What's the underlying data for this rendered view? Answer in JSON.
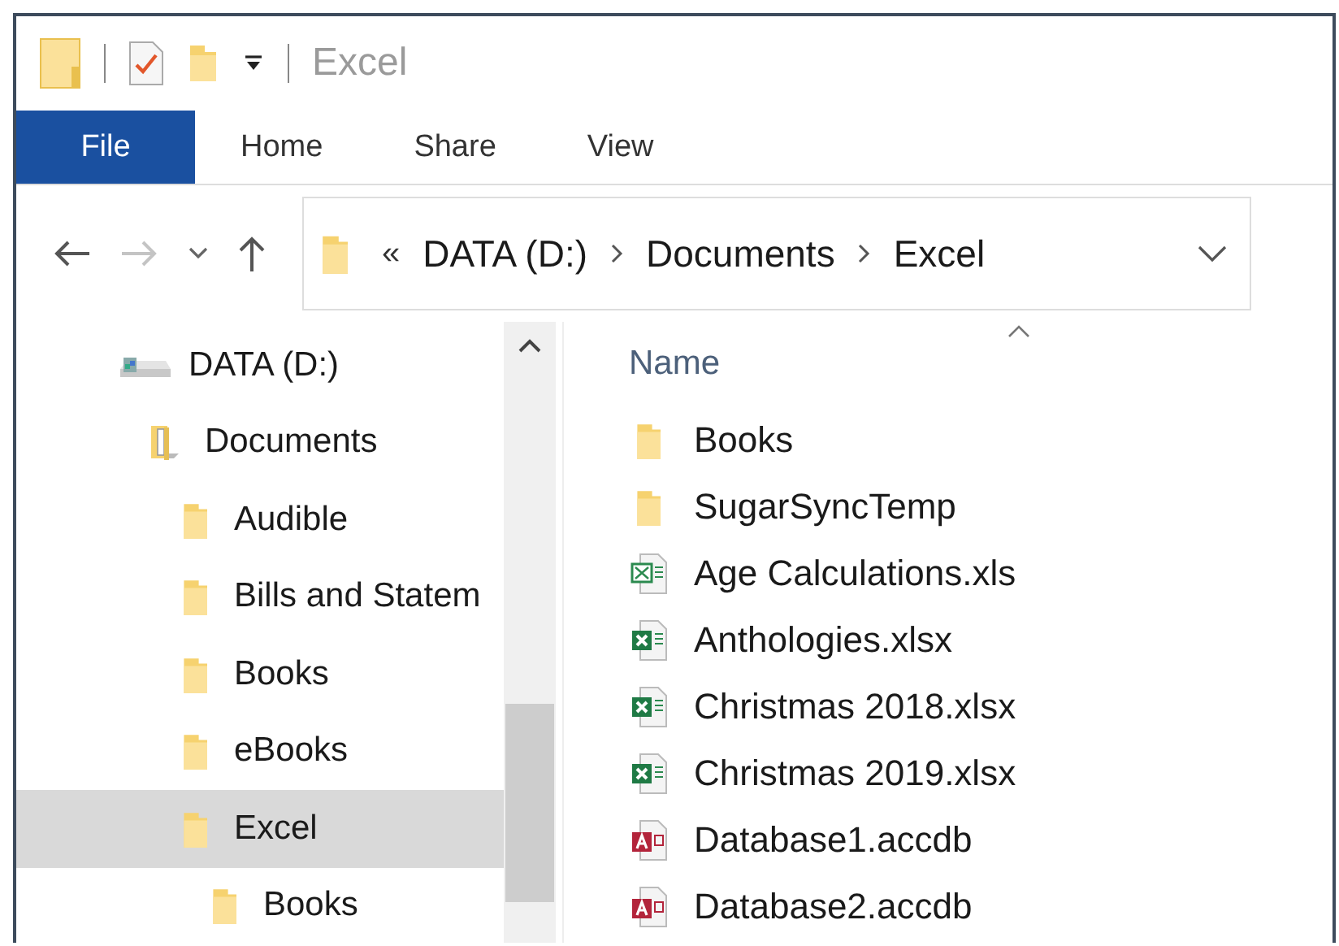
{
  "window": {
    "title": "Excel"
  },
  "quick_access": [
    {
      "kind": "folder"
    },
    {
      "kind": "properties"
    },
    {
      "kind": "new-folder"
    },
    {
      "kind": "customize"
    }
  ],
  "ribbon_tabs": [
    {
      "label": "File",
      "selected": true
    },
    {
      "label": "Home",
      "selected": false
    },
    {
      "label": "Share",
      "selected": false
    },
    {
      "label": "View",
      "selected": false
    }
  ],
  "navigation": {
    "back_disabled": false,
    "forward_disabled": true
  },
  "address_bar": {
    "overflow": "«",
    "path": [
      "DATA (D:)",
      "Documents",
      "Excel"
    ]
  },
  "navigation_pane": {
    "items": [
      {
        "label": "DATA (D:)",
        "kind": "drive",
        "selected": false,
        "children": [
          {
            "label": "Documents",
            "kind": "library",
            "selected": false,
            "children": [
              {
                "label": "Audible",
                "kind": "folder",
                "selected": false
              },
              {
                "label": "Bills and Statem",
                "kind": "folder",
                "selected": false
              },
              {
                "label": "Books",
                "kind": "folder",
                "selected": false
              },
              {
                "label": "eBooks",
                "kind": "folder",
                "selected": false
              },
              {
                "label": "Excel",
                "kind": "folder",
                "selected": true,
                "children": [
                  {
                    "label": "Books",
                    "kind": "folder",
                    "selected": false
                  }
                ]
              }
            ]
          }
        ]
      }
    ]
  },
  "file_list": {
    "columns": [
      "Name"
    ],
    "rows": [
      {
        "name": "Books",
        "kind": "folder"
      },
      {
        "name": "SugarSyncTemp",
        "kind": "folder"
      },
      {
        "name": "Age Calculations.xls",
        "kind": "xls"
      },
      {
        "name": "Anthologies.xlsx",
        "kind": "xlsx"
      },
      {
        "name": "Christmas 2018.xlsx",
        "kind": "xlsx"
      },
      {
        "name": "Christmas 2019.xlsx",
        "kind": "xlsx"
      },
      {
        "name": "Database1.accdb",
        "kind": "accdb"
      },
      {
        "name": "Database2.accdb",
        "kind": "accdb"
      }
    ]
  }
}
